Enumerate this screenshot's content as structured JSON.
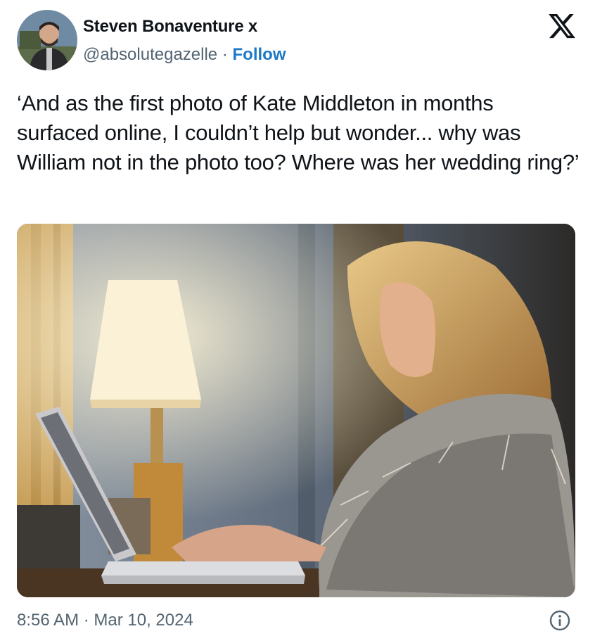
{
  "author": {
    "display_name": "Steven Bonaventure x",
    "handle": "@absolutegazelle",
    "separator": "·",
    "follow_label": "Follow",
    "avatar_icon": "user-avatar"
  },
  "brand": {
    "logo_icon": "x-logo-icon"
  },
  "tweet": {
    "text": "‘And as the first photo of Kate Middleton in months surfaced online, I couldn’t help but wonder... why was William not in the photo too? Where was her wedding ring?’"
  },
  "media": {
    "icon": "photo-woman-laptop-lamp"
  },
  "meta": {
    "timestamp": "8:56 AM · Mar 10, 2024",
    "info_icon": "info-icon"
  },
  "colors": {
    "follow": "#1d79c6",
    "muted": "#536471",
    "text": "#0f1419"
  }
}
